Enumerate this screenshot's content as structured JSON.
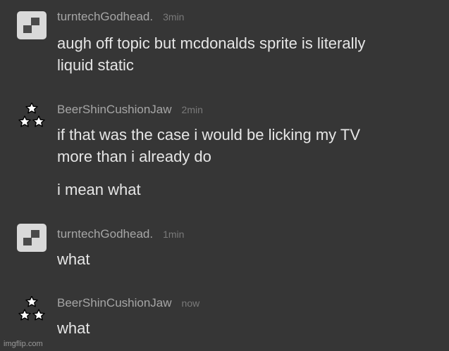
{
  "messages": [
    {
      "user": "turntechGodhead.",
      "time": "3min",
      "avatar_icon": "gray-pixel-avatar-icon",
      "lines": [
        "augh off topic but mcdonalds sprite is literally",
        "liquid static"
      ]
    },
    {
      "user": "BeerShinCushionJaw",
      "time": "2min",
      "avatar_icon": "three-stars-avatar-icon",
      "lines": [
        "if that was the case i would be licking my TV",
        "more than i already do"
      ],
      "extra": "i mean what"
    },
    {
      "user": "turntechGodhead.",
      "time": "1min",
      "avatar_icon": "gray-pixel-avatar-icon",
      "lines": [
        "what"
      ]
    },
    {
      "user": "BeerShinCushionJaw",
      "time": "now",
      "avatar_icon": "three-stars-avatar-icon",
      "lines": [
        "what"
      ]
    }
  ],
  "watermark": "imgflip.com"
}
